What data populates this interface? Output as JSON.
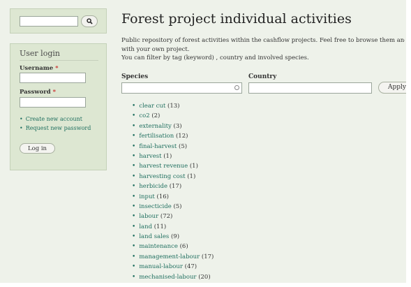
{
  "sidebar": {
    "search": {
      "button_icon": "search-icon",
      "value": ""
    },
    "login": {
      "title": "User login",
      "username_label": "Username",
      "password_label": "Password",
      "required_mark": "*",
      "links": [
        "Create new account",
        "Request new password"
      ],
      "login_button": "Log in"
    }
  },
  "main": {
    "title": "Forest project individual activities",
    "description": [
      "Public repository of forest activities within the cashflow projects. Feel free to browse them and com",
      "with your own project.",
      "You can filter by tag (keyword) , country and involved species."
    ],
    "filters": {
      "species_label": "Species",
      "country_label": "Country",
      "apply_label": "Apply"
    },
    "tags": [
      {
        "name": "clear cut",
        "count": "(13)"
      },
      {
        "name": "co2",
        "count": "(2)"
      },
      {
        "name": "externality",
        "count": "(3)"
      },
      {
        "name": "fertilisation",
        "count": "(12)"
      },
      {
        "name": "final-harvest",
        "count": "(5)"
      },
      {
        "name": "harvest",
        "count": "(1)"
      },
      {
        "name": "harvest revenue",
        "count": "(1)"
      },
      {
        "name": "harvesting cost",
        "count": "(1)"
      },
      {
        "name": "herbicide",
        "count": "(17)"
      },
      {
        "name": "input",
        "count": "(16)"
      },
      {
        "name": "insecticide",
        "count": "(5)"
      },
      {
        "name": "labour",
        "count": "(72)"
      },
      {
        "name": "land",
        "count": "(11)"
      },
      {
        "name": "land sales",
        "count": "(9)"
      },
      {
        "name": "maintenance",
        "count": "(6)"
      },
      {
        "name": "management-labour",
        "count": "(17)"
      },
      {
        "name": "manual-labour",
        "count": "(47)"
      },
      {
        "name": "mechanised-labour",
        "count": "(20)"
      }
    ]
  }
}
